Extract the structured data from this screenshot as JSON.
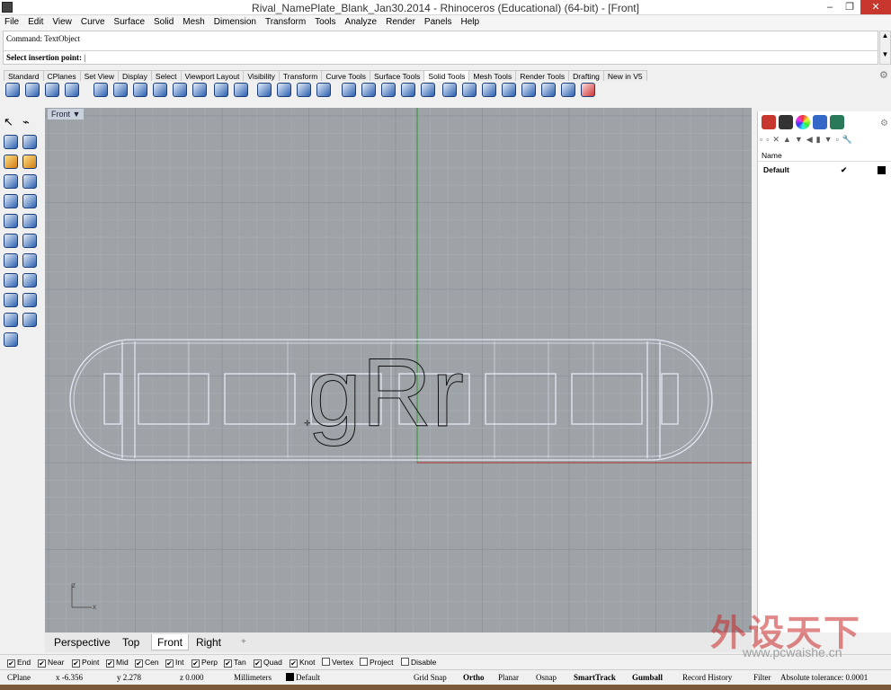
{
  "window": {
    "title": "Rival_NamePlate_Blank_Jan30.2014 - Rhinoceros (Educational) (64-bit) - [Front]",
    "minimize": "–",
    "restore": "❐",
    "close": "✕"
  },
  "menu": [
    "File",
    "Edit",
    "View",
    "Curve",
    "Surface",
    "Solid",
    "Mesh",
    "Dimension",
    "Transform",
    "Tools",
    "Analyze",
    "Render",
    "Panels",
    "Help"
  ],
  "command": {
    "history": "Command: TextObject",
    "prompt": "Select insertion point:",
    "scroll_up": "▲",
    "scroll_down": "▼"
  },
  "toolbar_tabs": [
    "Standard",
    "CPlanes",
    "Set View",
    "Display",
    "Select",
    "Viewport Layout",
    "Visibility",
    "Transform",
    "Curve Tools",
    "Surface Tools",
    "Solid Tools",
    "Mesh Tools",
    "Render Tools",
    "Drafting",
    "New in V5"
  ],
  "active_toolbar_tab": "Solid Tools",
  "viewport": {
    "label": "Front",
    "dropdown": "▼",
    "text_object": "gRr",
    "axis_z": "z",
    "axis_x": "x"
  },
  "viewport_tabs": [
    "Perspective",
    "Top",
    "Front",
    "Right"
  ],
  "active_viewport_tab": "Front",
  "add_viewport_tab": "+",
  "layers_panel": {
    "column_name": "Name",
    "layers": [
      {
        "name": "Default",
        "current": "✔",
        "color": "#000000"
      }
    ]
  },
  "osnaps": [
    {
      "label": "End",
      "checked": true
    },
    {
      "label": "Near",
      "checked": true
    },
    {
      "label": "Point",
      "checked": true
    },
    {
      "label": "Mid",
      "checked": true
    },
    {
      "label": "Cen",
      "checked": true
    },
    {
      "label": "Int",
      "checked": true
    },
    {
      "label": "Perp",
      "checked": true
    },
    {
      "label": "Tan",
      "checked": true
    },
    {
      "label": "Quad",
      "checked": true
    },
    {
      "label": "Knot",
      "checked": true
    },
    {
      "label": "Vertex",
      "checked": false
    },
    {
      "label": "Project",
      "checked": false
    },
    {
      "label": "Disable",
      "checked": false
    }
  ],
  "status": {
    "cplane": "CPlane",
    "x": "x -6.356",
    "y": "y 2.278",
    "z": "z 0.000",
    "units": "Millimeters",
    "layer": "Default",
    "grid_snap": "Grid Snap",
    "ortho": "Ortho",
    "planar": "Planar",
    "osnap": "Osnap",
    "smarttrack": "SmartTrack",
    "gumball": "Gumball",
    "record_history": "Record History",
    "filter": "Filter",
    "tolerance": "Absolute tolerance: 0.0001"
  },
  "colors": {
    "viewport_bg": "#9ea3a8",
    "grid_minor": "#a8adb2",
    "grid_major": "#8c9197",
    "axis_x": "#b03030",
    "axis_y": "#2a9a2a",
    "part_outline": "#dde2ef",
    "text_curves": "#111111",
    "toolbar_icon": "#2a5fb0"
  },
  "watermark": {
    "text": "外设天下",
    "url": "www.pcwaishe.cn"
  }
}
